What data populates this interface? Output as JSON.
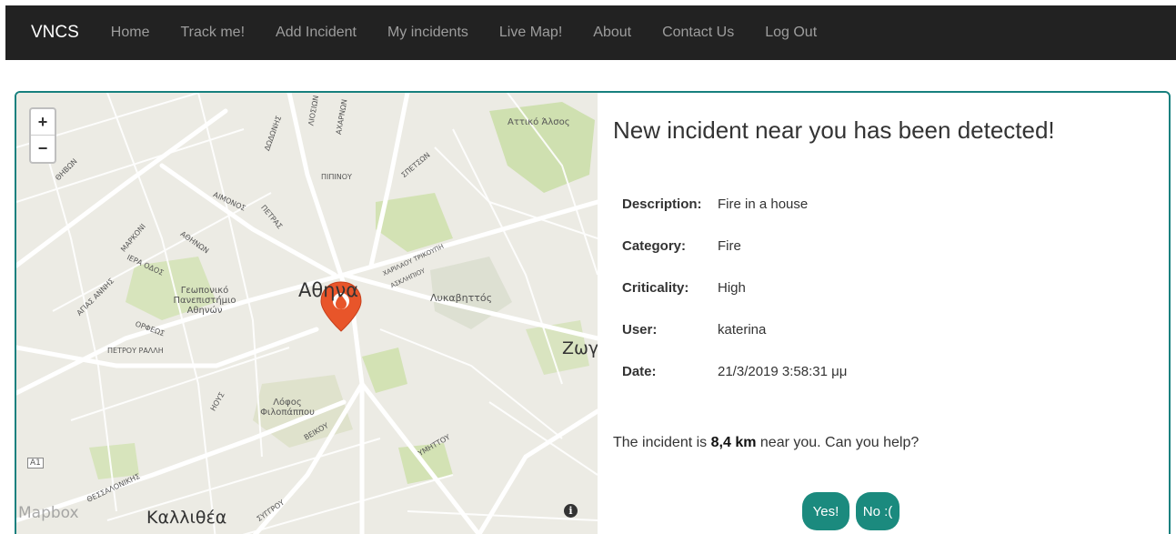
{
  "navbar": {
    "brand": "VNCS",
    "items": [
      "Home",
      "Track me!",
      "Add Incident",
      "My incidents",
      "Live Map!",
      "About",
      "Contact Us",
      "Log Out"
    ]
  },
  "map": {
    "zoom_in": "+",
    "zoom_out": "−",
    "labels": {
      "athens": "Αθηνα",
      "kallithea": "Καλλιθέα",
      "lykavittos": "Λυκαβηττός",
      "university": "Γεωπονικό Πανεπιστήμιο Αθηνών",
      "filopappou": "Λόφος Φιλοπάππου",
      "attiko_alsos": "Αττικό Άλσος",
      "zografou": "Ζωγ",
      "road_a1": "A1",
      "thivon": "ΘΗΒΩΝ",
      "pipinou": "ΠΙΠΙΝΟΥ",
      "acharnon": "ΑΧΑΡΝΩΝ",
      "liosion": "ΛΙΟΣΙΩΝ",
      "dodonis": "ΔΩΔΩΝΗΣ",
      "spetson": "ΣΠΕΤΣΩΝ",
      "aimonos": "ΑΙΜΟΝΟΣ",
      "petras": "ΠΕΤΡΑΣ",
      "athinon": "ΑΘΗΝΩΝ",
      "markoni": "ΜΑΡΚΟΝΙ",
      "iera_odos": "ΙΕΡΑ ΟΔΟΣ",
      "agias_annis": "ΑΓΙΑΣ ΑΝΝΗΣ",
      "orfeos": "ΟΡΦΕΩΣ",
      "petrou_ralli": "ΠΕΤΡΟΥ ΡΑΛΛΗ",
      "vasilissis_sofias": "ΧΑΡΙΛΑΟΥ ΤΡΙΚΟΥΠΗ",
      "asklipiou": "ΑΣΚΛΗΠΙΟΥ",
      "veikou": "ΒΕΙΚΟΥ",
      "ymittou": "ΥΜΗΤΤΟΥ",
      "thessalonikis": "ΘΕΣΣΑΛΟΝΙΚΗΣ",
      "syggrou": "ΣΥΓΓΡΟΥ",
      "iouis": "ΗΟΥΣ",
      "mapbox": "Mapbox"
    },
    "info": "i",
    "marker_color": "#e8552a"
  },
  "incident": {
    "heading": "New incident near you has been detected!",
    "fields": [
      {
        "key": "Description:",
        "value": "Fire in a house"
      },
      {
        "key": "Category:",
        "value": "Fire"
      },
      {
        "key": "Criticality:",
        "value": "High"
      },
      {
        "key": "User:",
        "value": "katerina"
      },
      {
        "key": "Date:",
        "value": "21/3/2019 3:58:31 μμ"
      }
    ],
    "distance_prefix": "The incident is",
    "distance_value": "8,4 km",
    "distance_suffix": "near you. Can you help?",
    "yes_label": "Yes!",
    "no_label": "No :("
  },
  "colors": {
    "navbar_bg": "#222222",
    "accent": "#1b8a7e",
    "panel_border": "#17807e"
  }
}
